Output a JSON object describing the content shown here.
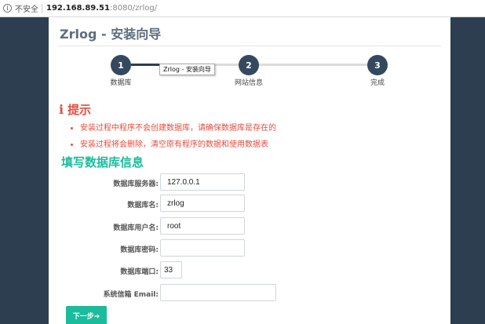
{
  "browser": {
    "security_label": "不安全",
    "url_host": "192.168.89.51",
    "url_path": ":8080/zrlog/"
  },
  "page": {
    "title": "Zrlog - 安装向导"
  },
  "wizard": {
    "steps": [
      {
        "number": "1",
        "label": "数据库"
      },
      {
        "number": "2",
        "label": "网站信息"
      },
      {
        "number": "3",
        "label": "完成"
      }
    ],
    "current_step": 1,
    "tooltip": "Zrlog - 安装向导"
  },
  "notice": {
    "icon": "info-icon",
    "heading": "提示",
    "items": [
      "安装过程中程序不会创建数据库，请确保数据库是存在的",
      "安装过程将会删除，清空原有程序的数据和使用数据表"
    ]
  },
  "form": {
    "heading": "填写数据库信息",
    "fields": [
      {
        "label": "数据库服务器:",
        "value": "127.0.0.1"
      },
      {
        "label": "数据库名:",
        "value": "zrlog"
      },
      {
        "label": "数据库用户名:",
        "value": "root"
      },
      {
        "label": "数据库密码:",
        "value": ""
      },
      {
        "label": "数据库端口:",
        "value": "33"
      },
      {
        "label": "系统信箱 Email:",
        "value": ""
      }
    ],
    "next_label": "下一步➔"
  },
  "colors": {
    "sidebar_bg": "#2c3e50",
    "step_dot": "#34495e",
    "notice": "#e74c3c",
    "accent": "#1abc9c"
  }
}
